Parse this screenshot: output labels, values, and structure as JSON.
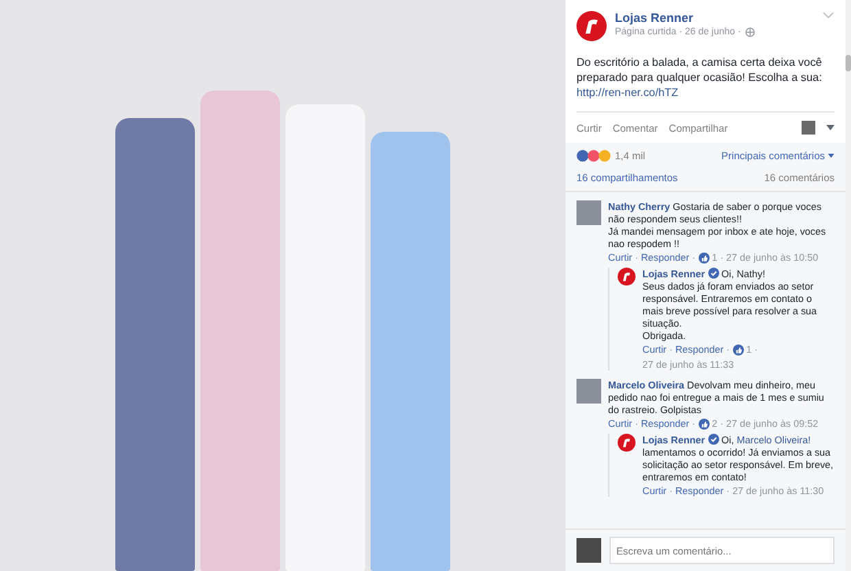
{
  "post": {
    "author": "Lojas Renner",
    "subtitle": "Página curtida · 26 de junho ·",
    "text": "Do escritório a balada, a camisa certa deixa você preparado para qualquer ocasião! Escolha a sua:",
    "link": "http://ren-ner.co/hTZ"
  },
  "actions": [
    "Curtir",
    "Comentar",
    "Compartilhar"
  ],
  "reactions": {
    "count": "1,4 mil",
    "sort": "Principais comentários"
  },
  "stats": {
    "shares": "16 compartilhamentos",
    "comments": "16 comentários"
  },
  "separator": "·",
  "comments": [
    {
      "author": "Nathy Cherry",
      "kind": "person",
      "verified": false,
      "text": "Gostaria de saber o porque voces não respondem seus clientes!!\nJá mandei mensagem por inbox e ate hoje, voces nao respodem !!",
      "like": "Curtir",
      "reply": "Responder",
      "likes": "1",
      "time": "27 de junho às 10:50",
      "children": [
        {
          "author": "Lojas Renner",
          "kind": "page",
          "verified": true,
          "text": "Oi, Nathy!\nSeus dados já foram enviados ao setor responsável. Entraremos em contato o mais breve possível para resolver a sua situação.\nObrigada.",
          "like": "Curtir",
          "reply": "Responder",
          "likes": "1",
          "time": "27 de junho às 11:33"
        }
      ]
    },
    {
      "author": "Marcelo Oliveira",
      "kind": "person",
      "verified": false,
      "text": "Devolvam meu dinheiro, meu pedido nao foi entregue a mais de 1 mes e sumiu do rastreio. Golpistas",
      "like": "Curtir",
      "reply": "Responder",
      "likes": "2",
      "time": "27 de junho às 09:52",
      "children": [
        {
          "author": "Lojas Renner",
          "kind": "page",
          "verified": true,
          "greeting": "Oi,",
          "mention": "Marcelo Oliveira!",
          "text": "lamentamos o ocorrido! Já enviamos a sua solicitação ao setor responsável. Em breve, entraremos em contato!",
          "like": "Curtir",
          "reply": "Responder",
          "time": "27 de junho às 11:30"
        }
      ]
    }
  ],
  "composer": {
    "placeholder": "Escreva um comentário..."
  }
}
